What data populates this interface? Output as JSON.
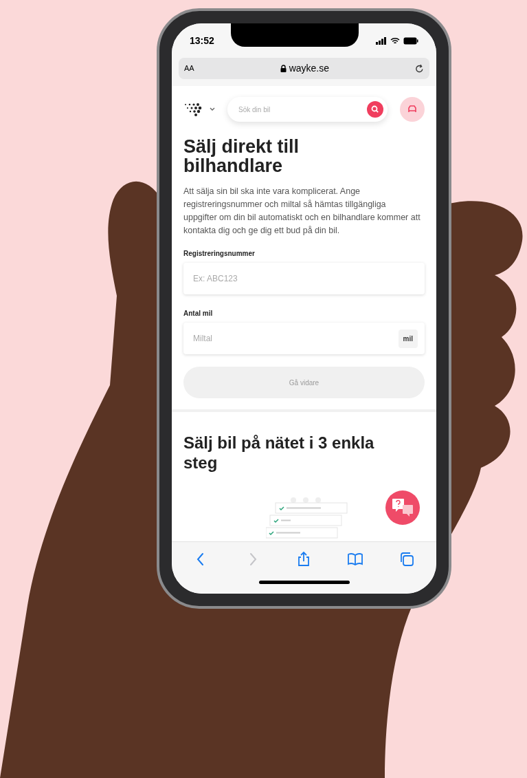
{
  "status_bar": {
    "time": "13:52"
  },
  "browser": {
    "text_size": "AA",
    "url": "wayke.se"
  },
  "header": {
    "search": {
      "placeholder": "Sök din bil"
    }
  },
  "hero": {
    "title": "Sälj direkt till bilhandlare",
    "intro": "Att sälja sin bil ska inte vara komplicerat. Ange registreringsnummer och miltal så hämtas tillgängliga uppgifter om din bil automatiskt och en bilhandlare kommer att kontakta dig och ge dig ett bud på din bil."
  },
  "form": {
    "fields": [
      {
        "label": "Registreringsnummer",
        "placeholder": "Ex: ABC123"
      },
      {
        "label": "Antal mil",
        "placeholder": "Miltal",
        "suffix": "mil"
      }
    ],
    "submit": {
      "label": "Gå vidare",
      "disabled": true
    }
  },
  "steps_section": {
    "title": "Sälj bil på nätet i 3 enkla steg"
  },
  "toolbar": {
    "items": [
      {
        "kind": "back",
        "disabled": false
      },
      {
        "kind": "forward",
        "disabled": true
      },
      {
        "kind": "share",
        "disabled": false
      },
      {
        "kind": "bookmarks",
        "disabled": false
      },
      {
        "kind": "tabs",
        "disabled": false
      }
    ]
  }
}
